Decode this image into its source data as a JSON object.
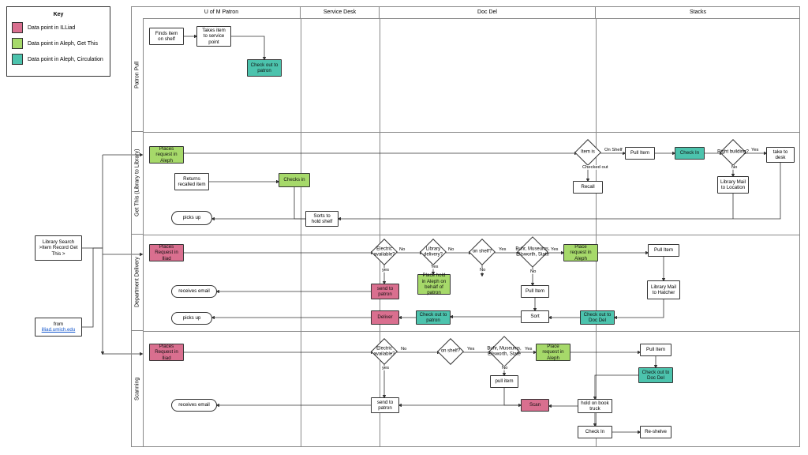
{
  "key": {
    "title": "Key",
    "items": [
      {
        "label": "Data point in ILLiad",
        "color": "pink"
      },
      {
        "label": "Data point in Aleph, Get This",
        "color": "green"
      },
      {
        "label": "Data point in Aleph, Circulation",
        "color": "teal"
      }
    ]
  },
  "columns": [
    "U of M Patron",
    "Service Desk",
    "Doc Del",
    "Stacks"
  ],
  "rows": [
    "Patron Pull",
    "Get This (Library to Library)",
    "Department Delivery",
    "Scanning"
  ],
  "entry": {
    "search": "Library Search >Item Record Get This >",
    "illiad_from": "from",
    "illiad_link": "illiad.umich.edu"
  },
  "patronPull": {
    "find": "Finds item on shelf",
    "take": "Takes item to service point",
    "checkout": "Check out to patron"
  },
  "getThis": {
    "place": "Places request in Aleph",
    "return": "Returns recalled item",
    "checkin": "Checks in",
    "pickup": "picks up",
    "sort": "Sorts to hold shelf",
    "itemIs": "Item is",
    "onShelf": "On Shelf",
    "checkedOut": "Checked out",
    "recall": "Recall",
    "pull": "Pull Item",
    "checkIn2": "Check In",
    "building": "Right building?",
    "mail": "Library Mail to Location",
    "take": "take to desk",
    "yes": "Yes",
    "no": "No"
  },
  "deptDel": {
    "place": "Places Request in Iliad",
    "receives": "receives email",
    "pickup": "picks up",
    "elec": "Electric available?",
    "sendp": "send to patron",
    "libdel": "Library delivery?",
    "placeHold": "Place hold in Aleph on behalf of patron",
    "onshelf": "on shelf?",
    "buhr": "Buhr, Museums, Ellsworth, State",
    "placeAleph": "Place request in Aleph",
    "pull1": "Pull Item",
    "deliver": "Deliver",
    "checkoutp": "Check out to patron",
    "sort": "Sort",
    "checkoutdd": "Check out to Doc Del",
    "mail": "Library Mail to Hatcher",
    "pull2": "Pull Item",
    "yes": "yes",
    "no": "No",
    "Yes": "Yes"
  },
  "scan": {
    "place": "Places Request in Iliad",
    "receives": "receives email",
    "elec": "Electric available?",
    "onshelf": "on shelf?",
    "buhr": "Buhr, Museums, Ellsworth, State",
    "placeAleph": "Place request in Aleph",
    "pullitem": "pull item",
    "sendp": "send to patron",
    "scan": "Scan",
    "truck": "hold on book truck",
    "checkin": "Check In",
    "reshelve": "Re-shelve",
    "pull2": "Pull Item",
    "checkoutdd": "Check out to Doc Del",
    "yes": "yes",
    "Yes": "Yes",
    "No": "No"
  }
}
